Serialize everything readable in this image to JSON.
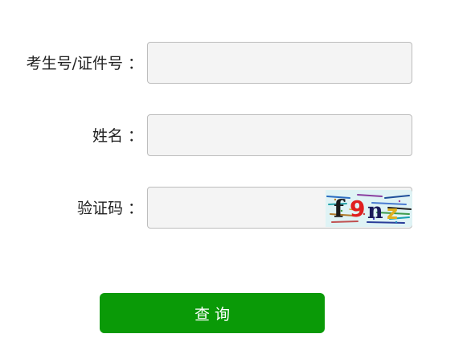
{
  "form": {
    "id_label": "考生号/证件号",
    "name_label": "姓名",
    "captcha_label": "验证码",
    "colon": "：",
    "id_value": "",
    "name_value": "",
    "captcha_value": "",
    "captcha_text": "f9nz",
    "submit_label": "查询"
  },
  "colors": {
    "submit_bg": "#0a9a07",
    "field_bg": "#f4f4f4",
    "field_border": "#bdbdbd"
  }
}
